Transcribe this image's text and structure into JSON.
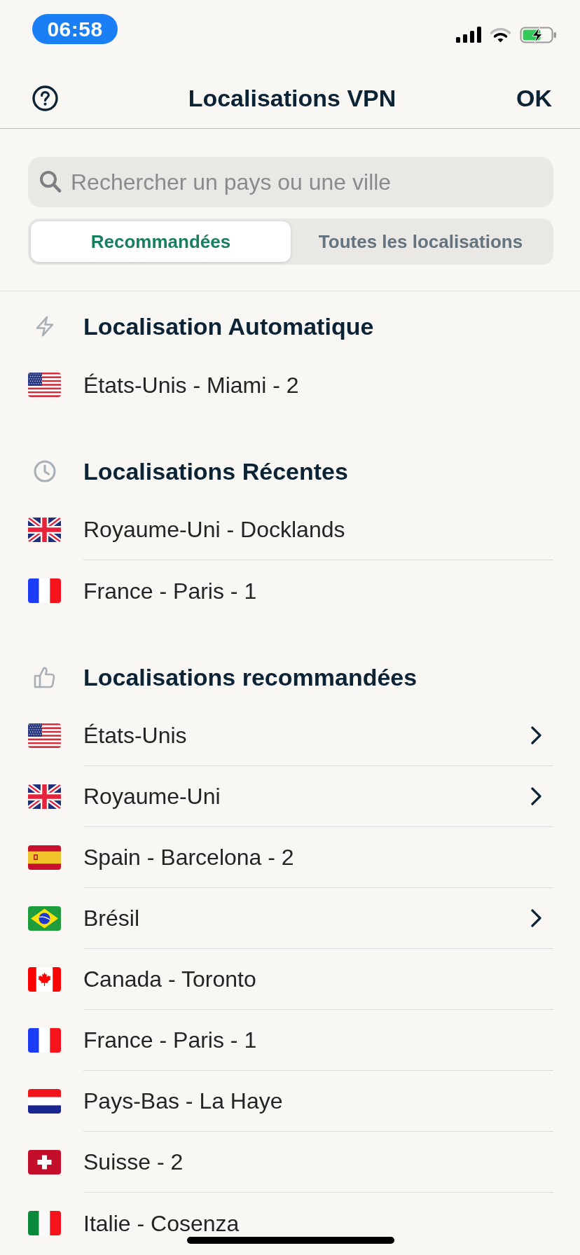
{
  "status_bar": {
    "time": "06:58"
  },
  "header": {
    "title": "Localisations VPN",
    "action": "OK"
  },
  "search": {
    "placeholder": "Rechercher un pays ou une ville"
  },
  "tabs": [
    {
      "label": "Recommandées",
      "selected": true
    },
    {
      "label": "Toutes les localisations",
      "selected": false
    }
  ],
  "sections": [
    {
      "kind": "automatic",
      "title": "Localisation Automatique",
      "items": [
        {
          "kind": "us",
          "label": "États-Unis - Miami - 2",
          "expandable": false
        }
      ]
    },
    {
      "kind": "recent",
      "title": "Localisations Récentes",
      "items": [
        {
          "kind": "gb",
          "label": "Royaume-Uni - Docklands",
          "expandable": false
        },
        {
          "kind": "fr",
          "label": "France - Paris - 1",
          "expandable": false
        }
      ]
    },
    {
      "kind": "recommended",
      "title": "Localisations recommandées",
      "items": [
        {
          "kind": "us",
          "label": "États-Unis",
          "expandable": true
        },
        {
          "kind": "gb",
          "label": "Royaume-Uni",
          "expandable": true
        },
        {
          "kind": "es",
          "label": "Spain - Barcelona - 2",
          "expandable": false
        },
        {
          "kind": "br",
          "label": "Brésil",
          "expandable": true
        },
        {
          "kind": "ca",
          "label": "Canada - Toronto",
          "expandable": false
        },
        {
          "kind": "fr",
          "label": "France - Paris - 1",
          "expandable": false
        },
        {
          "kind": "nl",
          "label": "Pays-Bas - La Haye",
          "expandable": false
        },
        {
          "kind": "ch",
          "label": "Suisse - 2",
          "expandable": false
        },
        {
          "kind": "it",
          "label": "Italie - Cosenza",
          "expandable": false
        }
      ]
    }
  ]
}
